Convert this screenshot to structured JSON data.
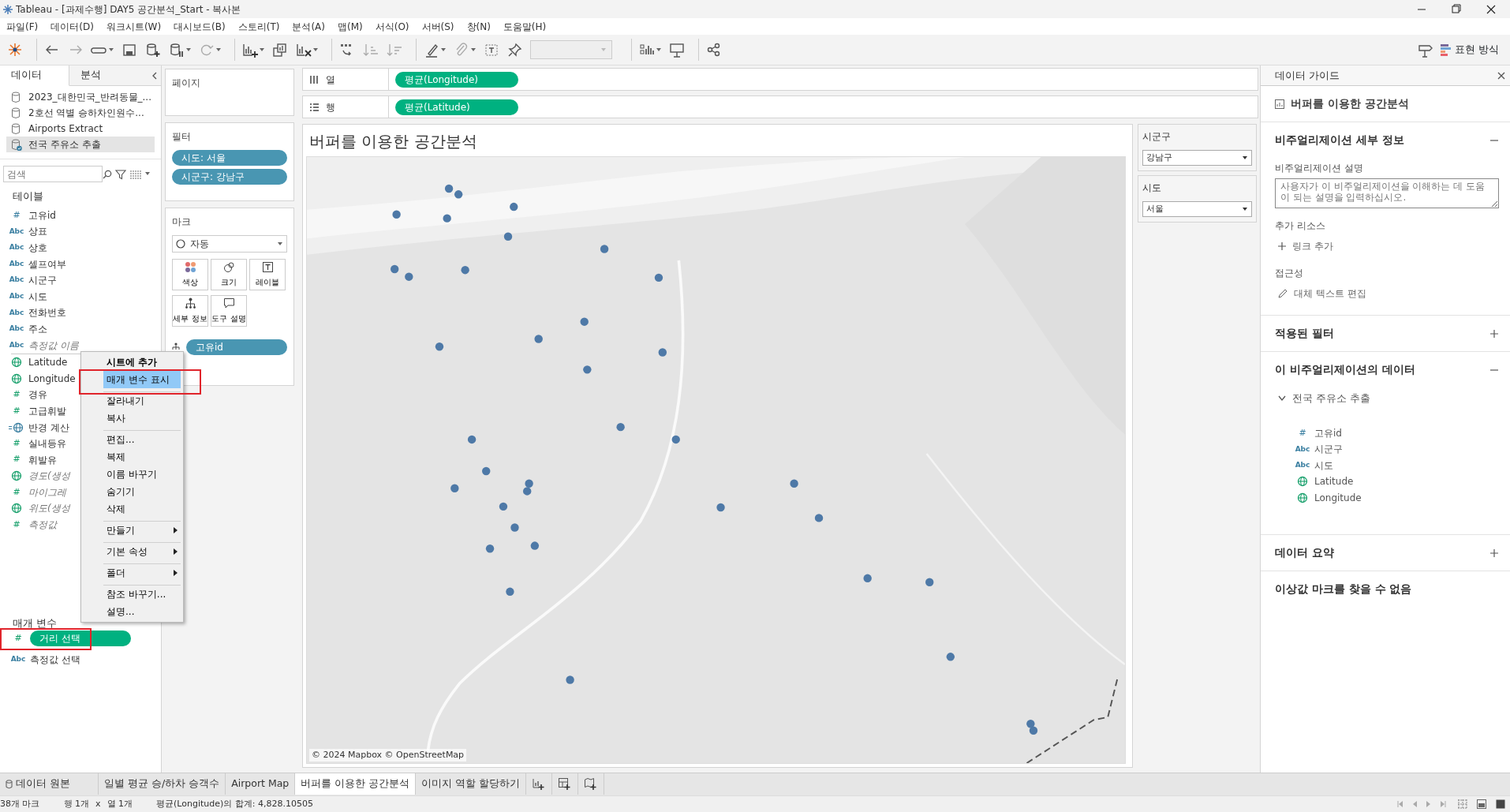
{
  "window": {
    "title": "Tableau - [과제수행] DAY5 공간분석_Start - 복사본"
  },
  "menu_bar": [
    "파일(F)",
    "데이터(D)",
    "워크시트(W)",
    "대시보드(B)",
    "스토리(T)",
    "분석(A)",
    "맵(M)",
    "서식(O)",
    "서버(S)",
    "창(N)",
    "도움말(H)"
  ],
  "toolbar": {
    "show_me_label": "표현 방식"
  },
  "data_pane": {
    "tabs": [
      {
        "label": "데이터",
        "selected": true
      },
      {
        "label": "분석",
        "selected": false
      }
    ],
    "sources": [
      {
        "name": "2023_대한민국_반려동물_...",
        "selected": false
      },
      {
        "name": "2호선 역별 승하차인원수...",
        "selected": false
      },
      {
        "name": "Airports Extract",
        "selected": false
      },
      {
        "name": "전국 주유소 추출",
        "selected": true
      }
    ],
    "search": {
      "placeholder": "검색"
    },
    "tables_heading": "테이블",
    "dimension_fields": [
      {
        "name": "고유id",
        "kind": "number",
        "type_label": "#",
        "generated": false
      },
      {
        "name": "상표",
        "kind": "text",
        "type_label": "Abc",
        "generated": false
      },
      {
        "name": "상호",
        "kind": "text",
        "type_label": "Abc",
        "generated": false
      },
      {
        "name": "셀프여부",
        "kind": "text",
        "type_label": "Abc",
        "generated": false
      },
      {
        "name": "시군구",
        "kind": "text",
        "type_label": "Abc",
        "generated": false
      },
      {
        "name": "시도",
        "kind": "text",
        "type_label": "Abc",
        "generated": false
      },
      {
        "name": "전화번호",
        "kind": "text",
        "type_label": "Abc",
        "generated": false
      },
      {
        "name": "주소",
        "kind": "text",
        "type_label": "Abc",
        "generated": false
      },
      {
        "name": "측정값 이름",
        "kind": "text",
        "type_label": "Abc",
        "generated": true
      }
    ],
    "measure_fields": [
      {
        "name": "Latitude",
        "kind": "geo",
        "generated": false
      },
      {
        "name": "Longitude",
        "kind": "geo",
        "generated": false
      },
      {
        "name": "경유",
        "kind": "number",
        "type_label": "#",
        "generated": false
      },
      {
        "name": "고급휘발",
        "kind": "number",
        "type_label": "#",
        "generated": false
      },
      {
        "name": "반경 계산",
        "kind": "calc-geo",
        "generated": false
      },
      {
        "name": "실내등유",
        "kind": "number",
        "type_label": "#",
        "generated": false
      },
      {
        "name": "휘발유",
        "kind": "number",
        "type_label": "#",
        "generated": false
      },
      {
        "name": "경도(생성",
        "kind": "geo",
        "generated": true
      },
      {
        "name": "마이그레",
        "kind": "number",
        "type_label": "#",
        "generated": true
      },
      {
        "name": "위도(생성",
        "kind": "geo",
        "generated": true
      },
      {
        "name": "측정값",
        "kind": "number",
        "type_label": "#",
        "generated": true
      }
    ],
    "parameters_heading": "매개 변수",
    "parameters": [
      {
        "name": "거리 선택",
        "kind": "number",
        "type_label": "#",
        "selected": true
      },
      {
        "name": "측정값 선택",
        "kind": "text",
        "type_label": "Abc",
        "selected": false
      }
    ]
  },
  "shelves": {
    "pages_label": "페이지",
    "filters_label": "필터",
    "filters": [
      "시도: 서울",
      "시군구: 강남구"
    ],
    "marks_label": "마크",
    "mark_type": "자동",
    "mark_buttons": [
      {
        "label": "색상",
        "kind": "color"
      },
      {
        "label": "크기",
        "kind": "size"
      },
      {
        "label": "레이블",
        "kind": "label"
      },
      {
        "label": "세부 정보",
        "kind": "detail"
      },
      {
        "label": "도구 설명",
        "kind": "tooltip"
      }
    ],
    "mark_fields": [
      "고유id"
    ]
  },
  "columns_shelf": {
    "label": "열",
    "pills": [
      "평균(Longitude)"
    ]
  },
  "rows_shelf": {
    "label": "행",
    "pills": [
      "평균(Latitude)"
    ]
  },
  "view": {
    "title": "버퍼를 이용한 공간분석",
    "attribution": "© 2024 Mapbox © OpenStreetMap"
  },
  "quick_filters": [
    {
      "title": "시군구",
      "value": "강남구"
    },
    {
      "title": "시도",
      "value": "서울"
    }
  ],
  "data_guide": {
    "title": "데이터 가이드",
    "sheet": "버퍼를 이용한 공간분석",
    "details": {
      "heading": "비주얼리제이션 세부 정보",
      "expanded": true,
      "description_label": "비주얼리제이션 설명",
      "description_placeholder": "사용자가 이 비주얼리제이션을 이해하는 데 도움이 되는 설명을 입력하십시오.",
      "resources_label": "추가 리소스",
      "add_link": "링크 추가",
      "accessibility_label": "접근성",
      "edit_alt_text": "대체 텍스트 편집"
    },
    "filters_section": {
      "heading": "적용된 필터",
      "expanded": false
    },
    "data_section": {
      "heading": "이 비주얼리제이션의 데이터",
      "expanded": true,
      "source": {
        "name": "전국 주유소 추출",
        "expanded": true,
        "fields": [
          {
            "name": "고유id",
            "kind": "number",
            "type_label": "#"
          },
          {
            "name": "시군구",
            "kind": "text",
            "type_label": "Abc"
          },
          {
            "name": "시도",
            "kind": "text",
            "type_label": "Abc"
          },
          {
            "name": "Latitude",
            "kind": "geo"
          },
          {
            "name": "Longitude",
            "kind": "geo"
          }
        ]
      }
    },
    "summary_section": {
      "heading": "데이터 요약",
      "expanded": false
    },
    "outliers_note": "이상값 마크를 찾을 수 없음"
  },
  "context_menu": {
    "groups": [
      [
        {
          "label": "시트에 추가",
          "kind": "header",
          "selected": false
        },
        {
          "label": "매개 변수 표시",
          "kind": "item",
          "selected": true
        }
      ],
      [
        {
          "label": "잘라내기",
          "kind": "item",
          "selected": false
        },
        {
          "label": "복사",
          "kind": "item",
          "selected": false
        }
      ],
      [
        {
          "label": "편집...",
          "kind": "item",
          "selected": false
        },
        {
          "label": "복제",
          "kind": "item",
          "selected": false
        },
        {
          "label": "이름 바꾸기",
          "kind": "item",
          "selected": false
        },
        {
          "label": "숨기기",
          "kind": "item",
          "selected": false
        },
        {
          "label": "삭제",
          "kind": "item",
          "selected": false
        }
      ],
      [
        {
          "label": "만들기",
          "kind": "submenu",
          "selected": false
        }
      ],
      [
        {
          "label": "기본 속성",
          "kind": "submenu",
          "selected": false
        }
      ],
      [
        {
          "label": "폴더",
          "kind": "submenu",
          "selected": false
        }
      ],
      [
        {
          "label": "참조 바꾸기...",
          "kind": "item",
          "selected": false
        },
        {
          "label": "설명...",
          "kind": "item",
          "selected": false
        }
      ]
    ]
  },
  "sheet_tabs": [
    {
      "label": "데이터 원본",
      "kind": "datasource",
      "selected": false
    },
    {
      "label": "일별 평균 승/하차 승객수",
      "kind": "sheet",
      "selected": false
    },
    {
      "label": "Airport Map",
      "kind": "sheet",
      "selected": false
    },
    {
      "label": "버퍼를 이용한 공간분석",
      "kind": "sheet",
      "selected": true
    },
    {
      "label": "이미지 역할 할당하기",
      "kind": "sheet",
      "selected": false
    }
  ],
  "status_bar": {
    "marks": "38개 마크",
    "rows": "행 1개",
    "times": "x",
    "columns": "열 1개",
    "summary": "평균(Longitude)의 합계: 4,828.10505"
  }
}
